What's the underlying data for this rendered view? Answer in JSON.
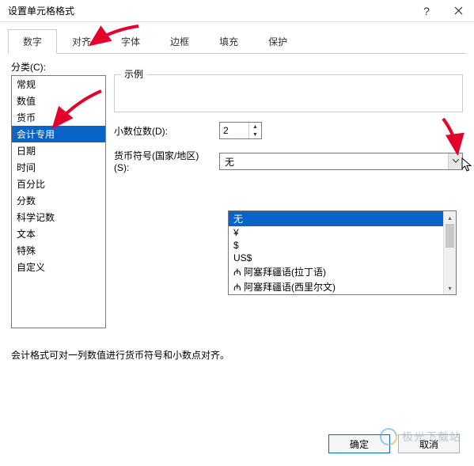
{
  "window": {
    "title": "设置单元格格式"
  },
  "tabs": [
    "数字",
    "对齐",
    "字体",
    "边框",
    "填充",
    "保护"
  ],
  "activeTab": 0,
  "categoryLabel": "分类(C):",
  "categories": [
    "常规",
    "数值",
    "货币",
    "会计专用",
    "日期",
    "时间",
    "百分比",
    "分数",
    "科学记数",
    "文本",
    "特殊",
    "自定义"
  ],
  "selectedCategory": 3,
  "sampleLabel": "示例",
  "decimalLabel": "小数位数(D):",
  "decimalValue": "2",
  "symbolLabel": "货币符号(国家/地区)(S):",
  "symbolValue": "无",
  "dropdownOptions": [
    "无",
    "¥",
    "$",
    "US$",
    "₼ 阿塞拜疆语(拉丁语)",
    "₼ 阿塞拜疆语(西里尔文)"
  ],
  "dropdownSelected": 0,
  "description": "会计格式可对一列数值进行货币符号和小数点对齐。",
  "buttons": {
    "ok": "确定",
    "cancel": "取消"
  },
  "watermark": "极光下载站"
}
